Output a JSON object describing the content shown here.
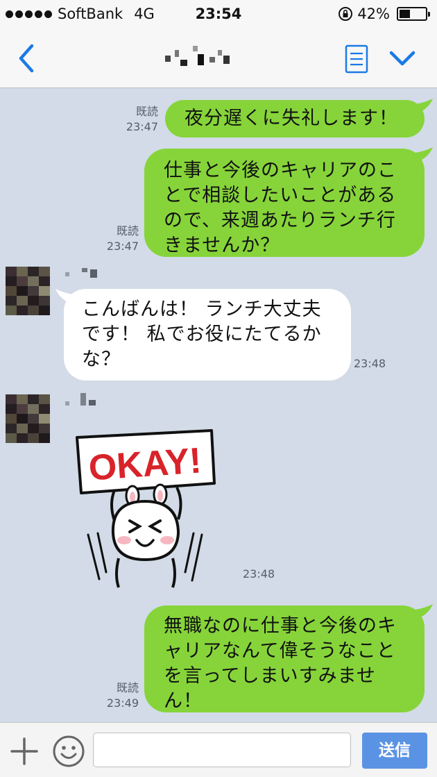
{
  "status_bar": {
    "carrier": "SoftBank",
    "network": "4G",
    "time": "23:54",
    "battery_percent": "42%",
    "battery_level": 0.42
  },
  "nav": {
    "back_icon": "chevron-left-icon",
    "notes_icon": "notes-icon",
    "menu_icon": "chevron-down-icon",
    "accent_color": "#1a7ae6"
  },
  "messages": [
    {
      "sender": "me",
      "read_label": "既読",
      "time": "23:47",
      "lines": [
        "夜分遅くに失礼します！"
      ]
    },
    {
      "sender": "me",
      "read_label": "既読",
      "time": "23:47",
      "lines": [
        "仕事と今後のキャリアのこ",
        "とで相談したいことがある",
        "ので、来週あたりランチ行",
        "きませんか？"
      ]
    },
    {
      "sender": "them",
      "time": "23:48",
      "lines": [
        "こんばんは！ ランチ大丈夫",
        "です！ 私でお役にたてるか",
        "な？"
      ]
    },
    {
      "sender": "them",
      "type": "sticker",
      "time": "23:48",
      "sticker_text": "OKAY!"
    },
    {
      "sender": "me",
      "read_label": "既読",
      "time": "23:49",
      "lines": [
        "無職なのに仕事と今後のキ",
        "ャリアなんて偉そうなこと",
        "を言ってしまいすみませ",
        "ん！"
      ]
    }
  ],
  "input_bar": {
    "placeholder": "",
    "send_label": "送信",
    "send_color": "#5a93e4"
  },
  "colors": {
    "my_bubble": "#86d43a",
    "their_bubble": "#ffffff",
    "background": "#d2dbe7"
  }
}
